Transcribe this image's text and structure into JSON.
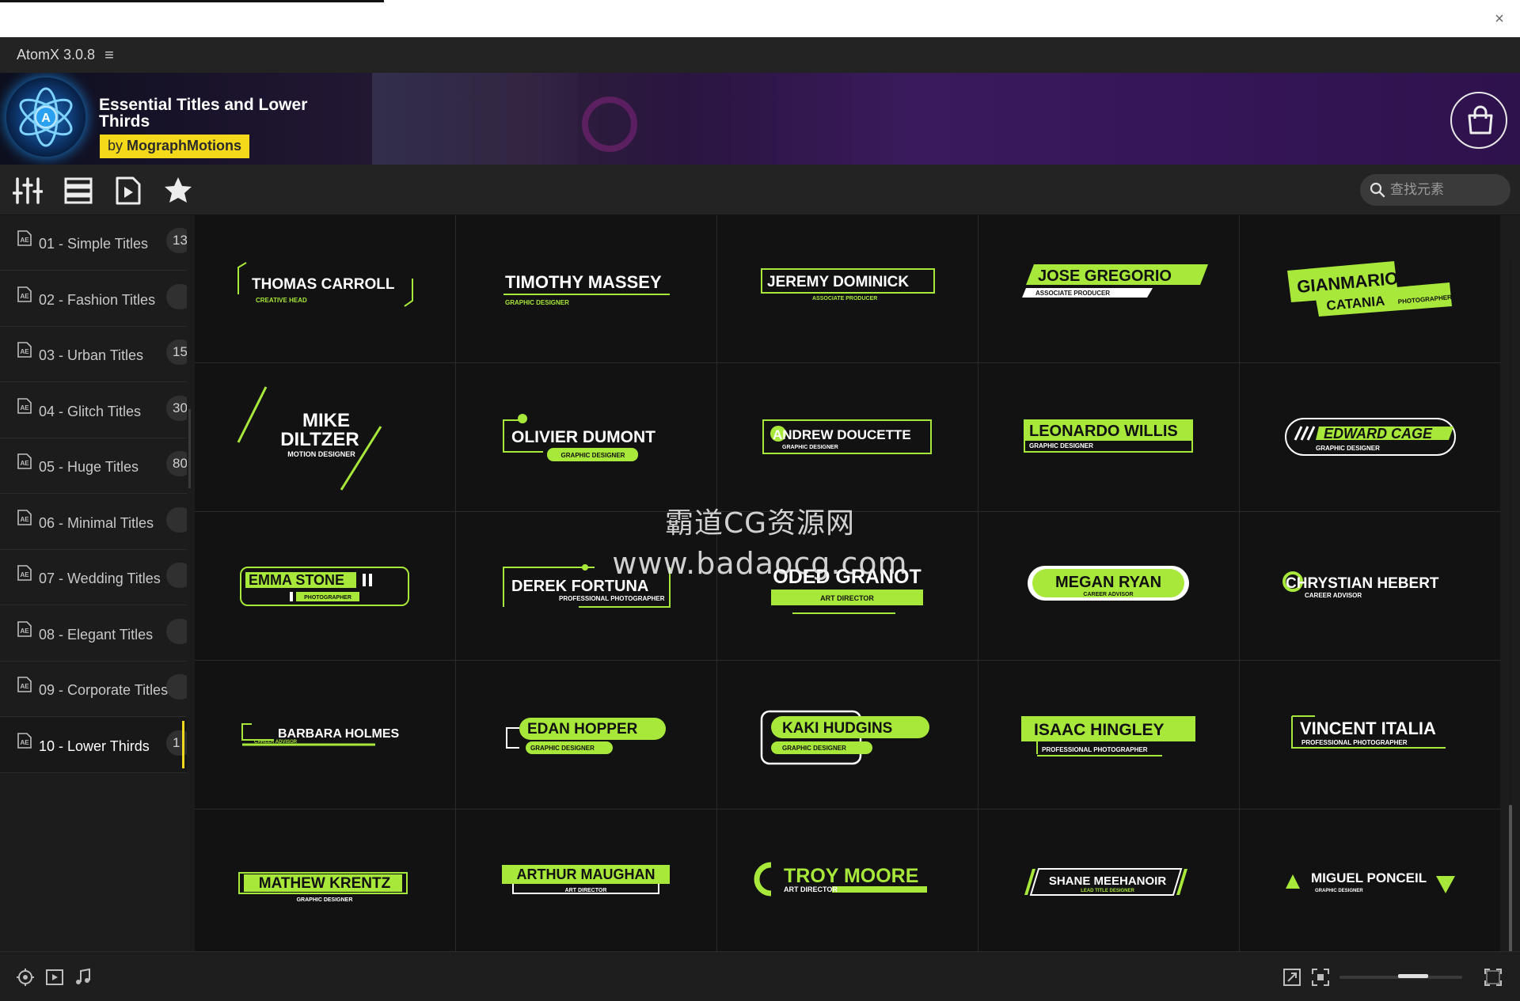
{
  "window": {
    "app_title": "AtomX 3.0.8",
    "close_glyph": "×",
    "menu_glyph": "≡"
  },
  "banner": {
    "product_title": "Essential Titles and Lower Thirds",
    "author_prefix": "by",
    "author": "MographMotions",
    "logo_letter": "A"
  },
  "search": {
    "placeholder": "查找元素"
  },
  "toolbar": {
    "icons": [
      "sliders-icon",
      "list-view-icon",
      "preview-icon",
      "favorites-star-icon"
    ]
  },
  "sidebar": {
    "items": [
      {
        "label": "01 - Simple Titles",
        "count": "13"
      },
      {
        "label": "02 - Fashion Titles",
        "count": ""
      },
      {
        "label": "03 - Urban Titles",
        "count": "15"
      },
      {
        "label": "04 - Glitch Titles",
        "count": "30"
      },
      {
        "label": "05 - Huge Titles",
        "count": "80"
      },
      {
        "label": "06 - Minimal Titles",
        "count": ""
      },
      {
        "label": "07 - Wedding Titles",
        "count": ""
      },
      {
        "label": "08 - Elegant Titles",
        "count": ""
      },
      {
        "label": "09 - Corporate Titles",
        "count": ""
      },
      {
        "label": "10 - Lower Thirds",
        "count": "1"
      }
    ],
    "active_index": 9
  },
  "accent_color": "#a8e83a",
  "highlight_color": "#f4d81a",
  "templates": [
    {
      "name": "THOMAS CARROLL",
      "role": "CREATIVE HEAD"
    },
    {
      "name": "TIMOTHY MASSEY",
      "role": "GRAPHIC DESIGNER"
    },
    {
      "name": "JEREMY DOMINICK",
      "role": "ASSOCIATE PRODUCER"
    },
    {
      "name": "JOSE GREGORIO",
      "role": "ASSOCIATE PRODUCER"
    },
    {
      "name": "GIANMARIO",
      "name2": "CATANIA",
      "role": "PHOTOGRAPHER"
    },
    {
      "name": "MIKE",
      "name2": "DILTZER",
      "role": "MOTION DESIGNER"
    },
    {
      "name": "OLIVIER DUMONT",
      "role": "GRAPHIC DESIGNER"
    },
    {
      "name": "ANDREW DOUCETTE",
      "role": "GRAPHIC DESIGNER"
    },
    {
      "name": "LEONARDO WILLIS",
      "role": "GRAPHIC DESIGNER"
    },
    {
      "name": "EDWARD CAGE",
      "role": "GRAPHIC DESIGNER"
    },
    {
      "name": "EMMA STONE",
      "role": "PHOTOGRAPHER"
    },
    {
      "name": "DEREK FORTUNA",
      "role": "PROFESSIONAL PHOTOGRAPHER"
    },
    {
      "name": "ODED GRANOT",
      "role": "ART DIRECTOR"
    },
    {
      "name": "MEGAN RYAN",
      "role": "CAREER ADVISOR"
    },
    {
      "name": "CHRYSTIAN HEBERT",
      "role": "CAREER ADVISOR"
    },
    {
      "name": "BARBARA HOLMES",
      "role": "CAREER ADVISOR"
    },
    {
      "name": "EDAN HOPPER",
      "role": "GRAPHIC DESIGNER"
    },
    {
      "name": "KAKI HUDGINS",
      "role": "GRAPHIC DESIGNER"
    },
    {
      "name": "ISAAC HINGLEY",
      "role": "PROFESSIONAL PHOTOGRAPHER"
    },
    {
      "name": "VINCENT ITALIA",
      "role": "PROFESSIONAL PHOTOGRAPHER"
    },
    {
      "name": "MATHEW KRENTZ",
      "role": "GRAPHIC DESIGNER"
    },
    {
      "name": "ARTHUR MAUGHAN",
      "role": "ART DIRECTOR"
    },
    {
      "name": "TROY MOORE",
      "role": "ART DIRECTOR"
    },
    {
      "name": "SHANE MEEHANOIR",
      "role": "LEAD TITLE DESIGNER"
    },
    {
      "name": "MIGUEL PONCEIL",
      "role": "GRAPHIC DESIGNER"
    }
  ],
  "watermark": {
    "line1": "霸道CG资源网",
    "line2": "www.badaocg.com"
  },
  "bottombar": {
    "icons": [
      "settings-icon",
      "video-icon",
      "music-icon",
      "export-icon",
      "fit-view-icon",
      "fullscreen-icon"
    ],
    "thumbnail_size": 0.6
  }
}
